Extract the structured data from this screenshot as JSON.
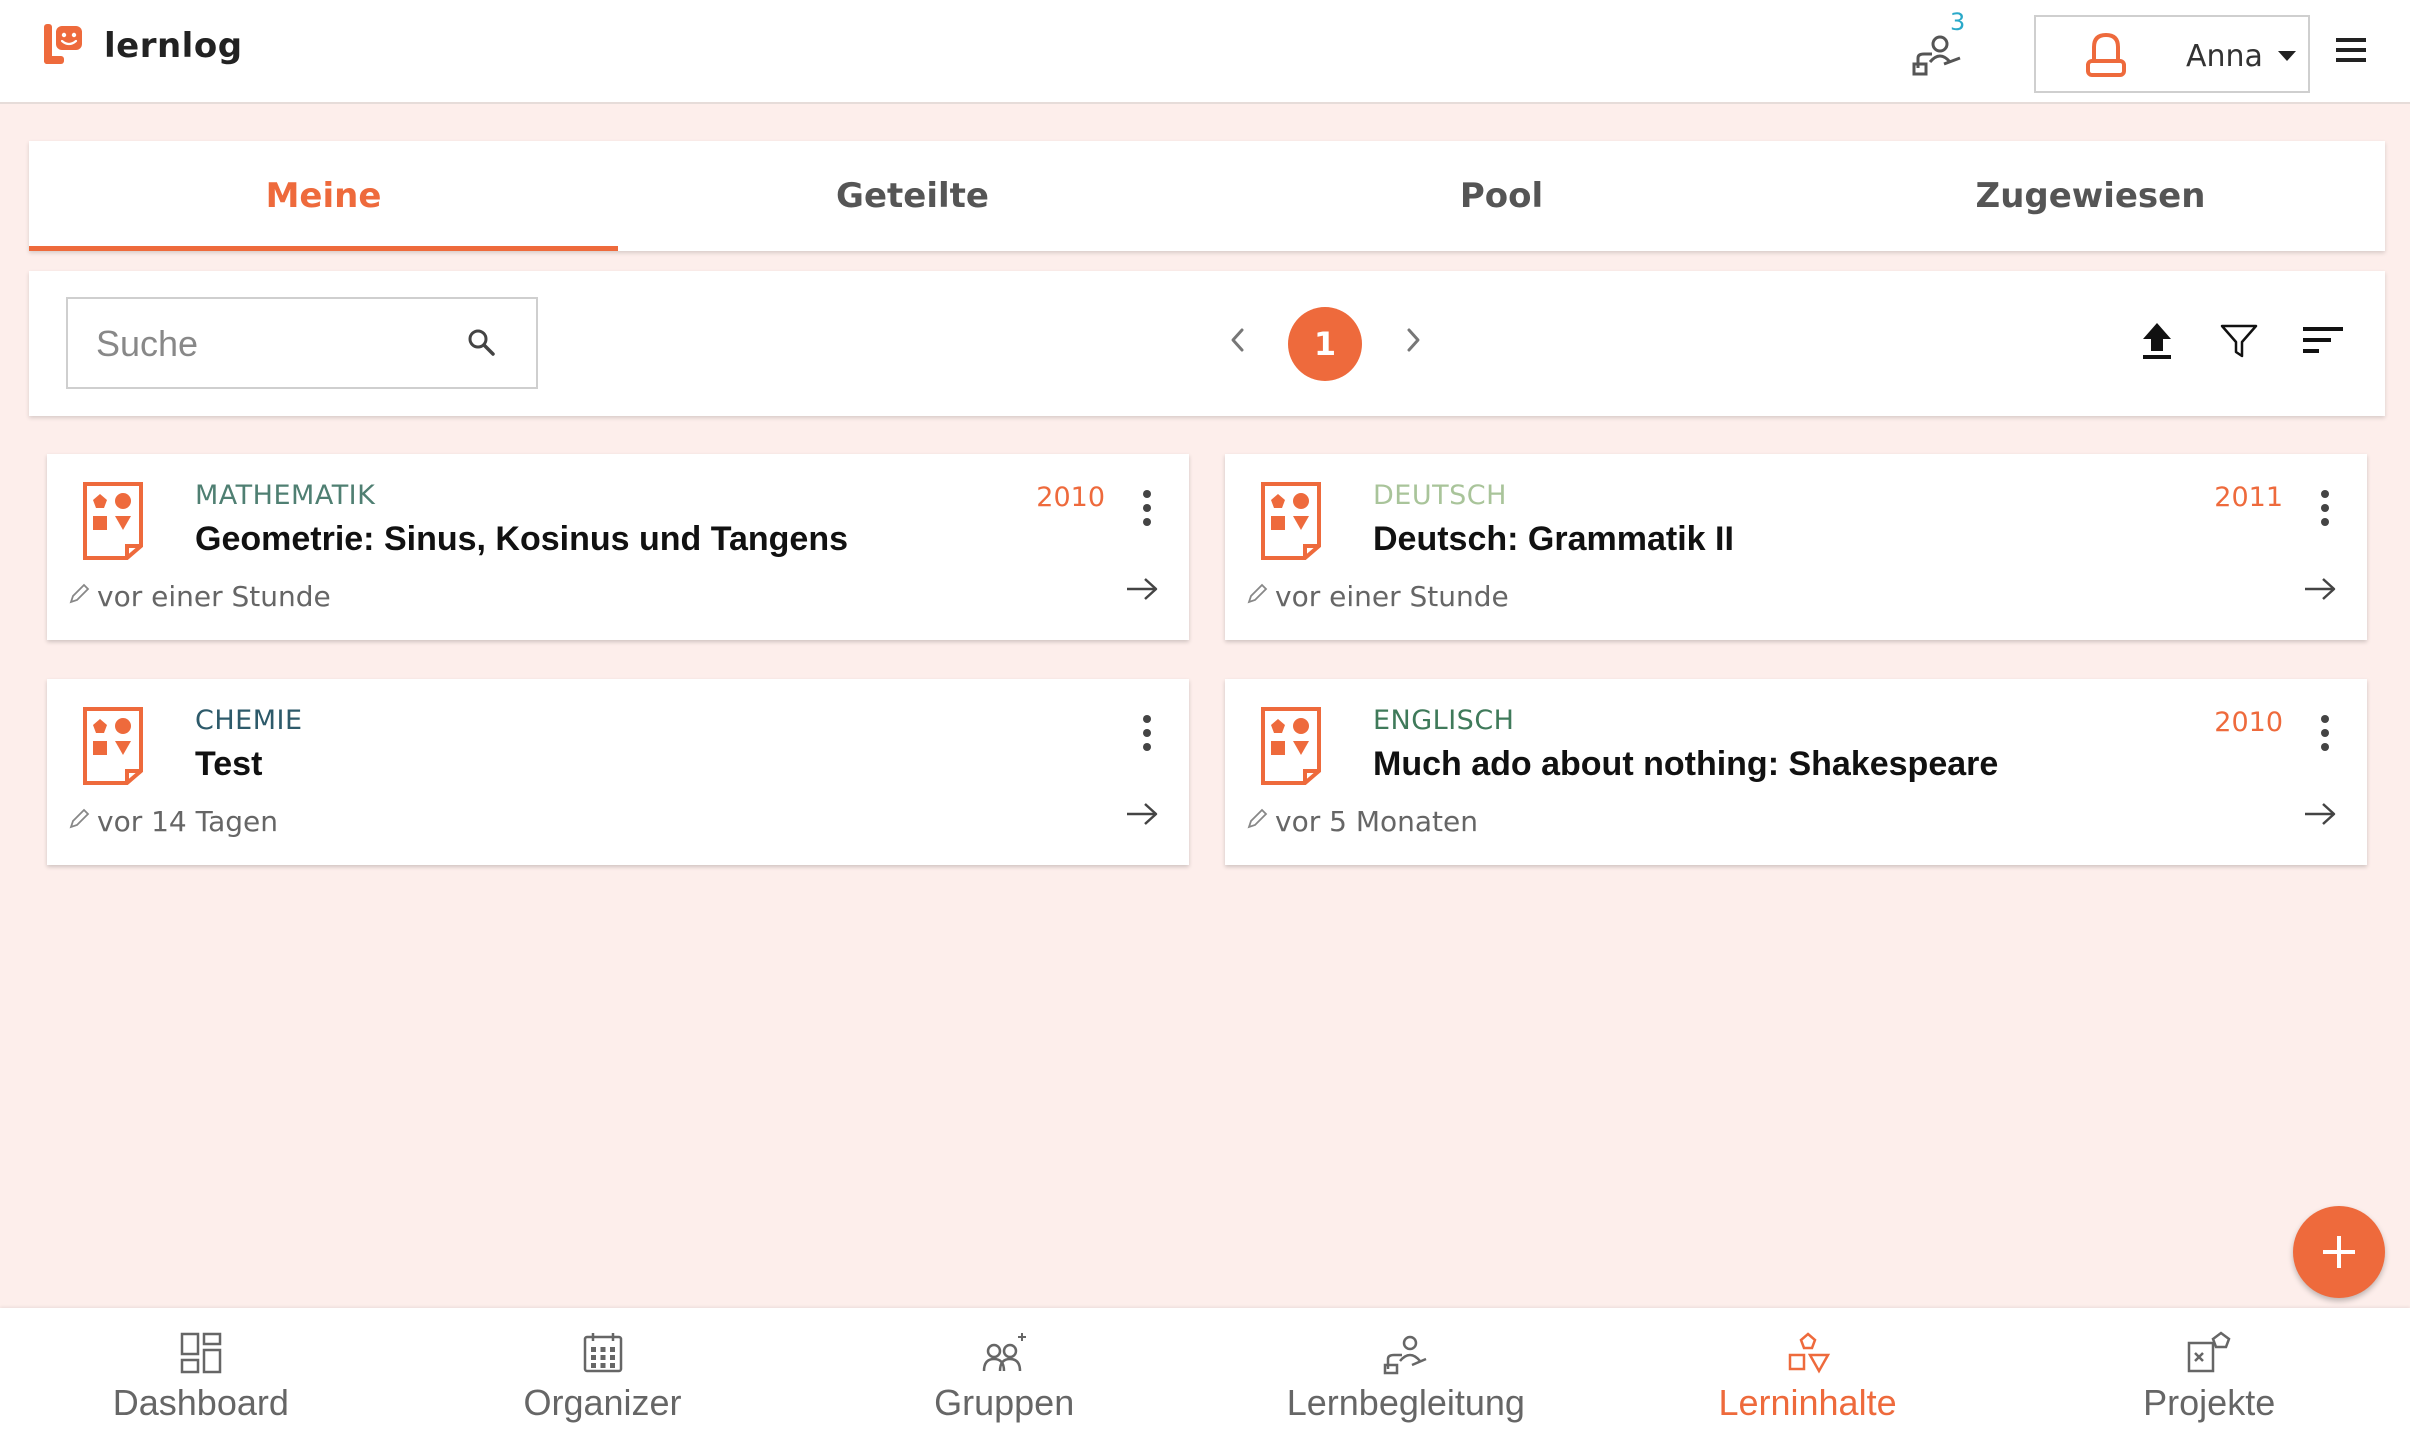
{
  "header": {
    "app_name": "lernlog",
    "notification_count": "3",
    "user_name": "Anna"
  },
  "tabs": [
    {
      "label": "Meine",
      "active": true
    },
    {
      "label": "Geteilte",
      "active": false
    },
    {
      "label": "Pool",
      "active": false
    },
    {
      "label": "Zugewiesen",
      "active": false
    }
  ],
  "toolbar": {
    "search_placeholder": "Suche",
    "current_page": "1"
  },
  "cards": [
    {
      "subject": "MATHEMATIK",
      "subject_color": "#4f7f72",
      "title": "Geometrie: Sinus, Kosinus und Tangens",
      "year": "2010",
      "modified": "vor einer Stunde"
    },
    {
      "subject": "DEUTSCH",
      "subject_color": "#a9c49a",
      "title": "Deutsch: Grammatik II",
      "year": "2011",
      "modified": "vor einer Stunde"
    },
    {
      "subject": "CHEMIE",
      "subject_color": "#2d5a6a",
      "title": "Test",
      "year": "",
      "modified": "vor 14 Tagen"
    },
    {
      "subject": "ENGLISCH",
      "subject_color": "#3f7a5a",
      "title": "Much ado about nothing: Shakespeare",
      "year": "2010",
      "modified": "vor 5 Monaten"
    }
  ],
  "bottom_nav": [
    {
      "label": "Dashboard",
      "icon": "dashboard-icon",
      "active": false
    },
    {
      "label": "Organizer",
      "icon": "calendar-icon",
      "active": false
    },
    {
      "label": "Gruppen",
      "icon": "group-icon",
      "active": false
    },
    {
      "label": "Lernbegleitung",
      "icon": "mentoring-icon",
      "active": false
    },
    {
      "label": "Lerninhalte",
      "icon": "learning-content-icon",
      "active": true
    },
    {
      "label": "Projekte",
      "icon": "projects-icon",
      "active": false
    }
  ],
  "colors": {
    "accent": "#ee6a3c",
    "background": "#fdeeeb",
    "notification": "#2aa9c9"
  }
}
